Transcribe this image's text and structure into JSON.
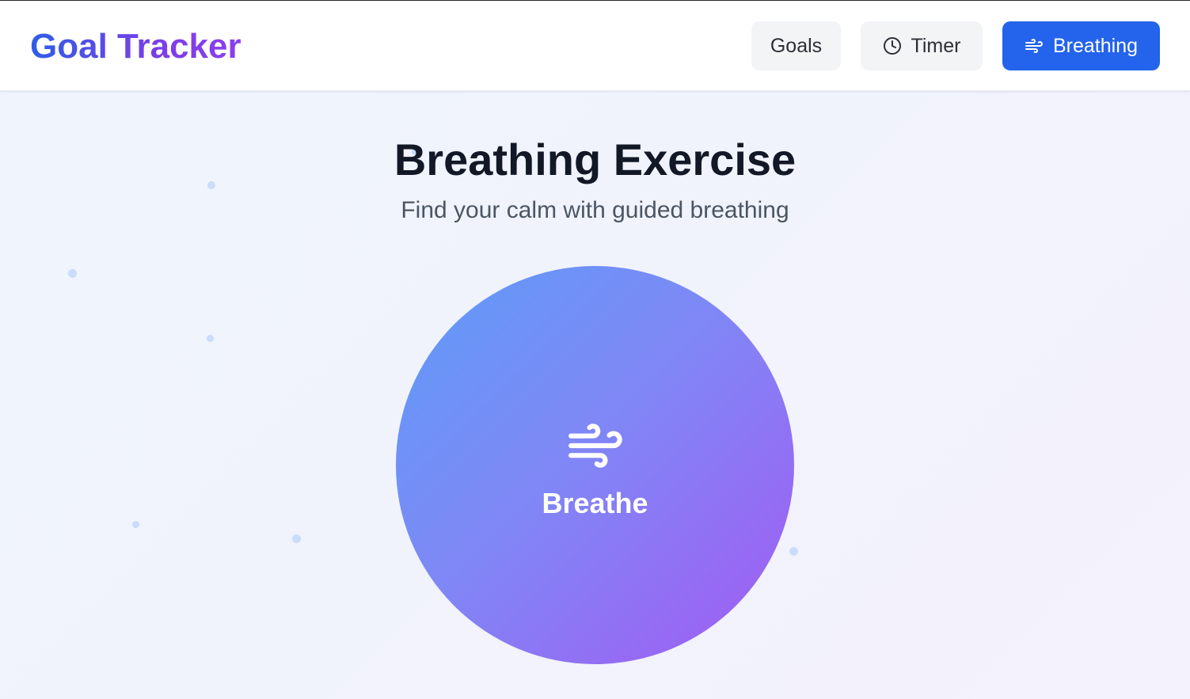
{
  "header": {
    "brand": "Goal Tracker",
    "nav": {
      "goals": "Goals",
      "timer": "Timer",
      "breathing": "Breathing",
      "active": "breathing"
    }
  },
  "main": {
    "title": "Breathing Exercise",
    "subtitle": "Find your calm with guided breathing",
    "circle_label": "Breathe"
  },
  "icons": {
    "timer": "clock-icon",
    "breathing": "wind-icon",
    "circle": "wind-icon"
  },
  "colors": {
    "accent": "#2463eb",
    "brand_start": "#2f5ee6",
    "brand_end": "#8b3ff0",
    "circle_start": "#5d9cf8",
    "circle_end": "#a25af2"
  }
}
